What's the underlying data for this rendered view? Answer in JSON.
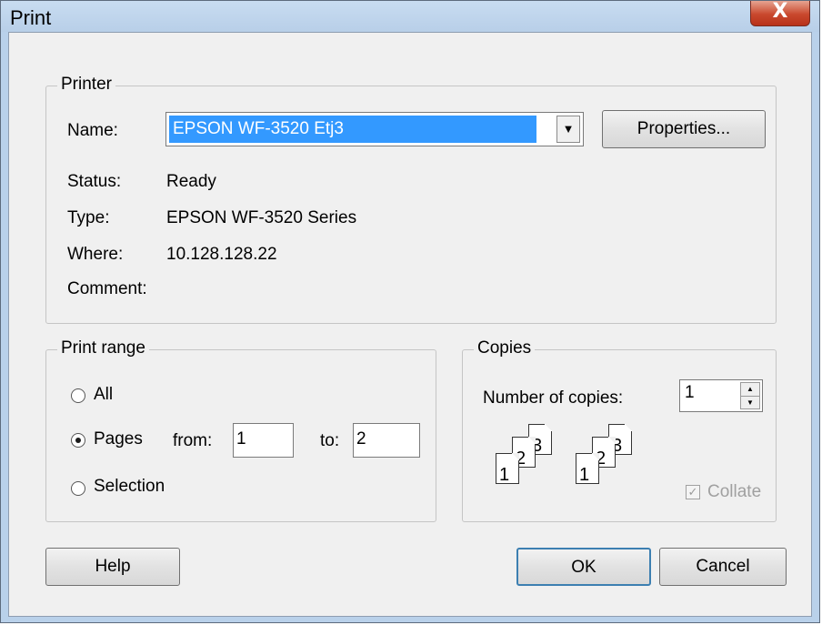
{
  "window": {
    "title": "Print",
    "close_glyph": "X"
  },
  "printer": {
    "legend": "Printer",
    "name_label": "Name:",
    "name_value": "EPSON WF-3520 Etj3",
    "properties_label": "Properties...",
    "status_label": "Status:",
    "status_value": "Ready",
    "type_label": "Type:",
    "type_value": "EPSON WF-3520 Series",
    "where_label": "Where:",
    "where_value": "10.128.128.22",
    "comment_label": "Comment:"
  },
  "print_range": {
    "legend": "Print range",
    "all_label": "All",
    "pages_label": "Pages",
    "from_label": "from:",
    "from_value": "1",
    "to_label": "to:",
    "to_value": "2",
    "selection_label": "Selection",
    "selected": "pages"
  },
  "copies": {
    "legend": "Copies",
    "number_label": "Number of copies:",
    "number_value": "1",
    "collate_label": "Collate",
    "collate_checked": true,
    "collate_icon_left": [
      "1",
      "2",
      "3"
    ],
    "collate_icon_right": [
      "1",
      "2",
      "3"
    ]
  },
  "buttons": {
    "help": "Help",
    "ok": "OK",
    "cancel": "Cancel"
  }
}
